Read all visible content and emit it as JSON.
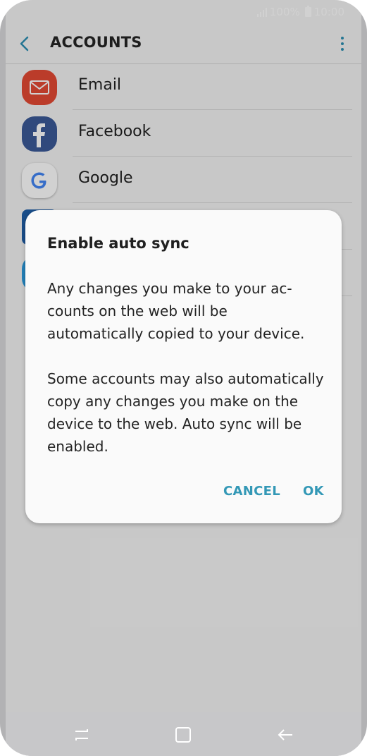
{
  "status_bar": {
    "battery": "100%",
    "time": "10:00"
  },
  "app_bar": {
    "title": "ACCOUNTS",
    "back_icon": "chevron-left-icon",
    "more_icon": "more-vert-icon"
  },
  "accounts": [
    {
      "label": "Email",
      "icon": "email-icon",
      "color": "#e54a34"
    },
    {
      "label": "Facebook",
      "icon": "facebook-icon",
      "color": "#3b5998"
    },
    {
      "label": "Google",
      "icon": "google-icon",
      "color": "#ffffff"
    }
  ],
  "dialog": {
    "title": "Enable auto sync",
    "paragraph1": "Any changes you make to your ac­counts on the web will be automatically copied to your device.",
    "paragraph2": "Some accounts may also automatically copy any changes you make on the device to the web. Auto sync will be enabled.",
    "cancel_label": "CANCEL",
    "ok_label": "OK"
  },
  "nav_bar": {
    "recent_icon": "recents-icon",
    "home_icon": "home-icon",
    "back_icon": "back-arrow-icon"
  },
  "colors": {
    "accent": "#3398b6",
    "scrim": "rgba(0,0,0,0.18)"
  }
}
